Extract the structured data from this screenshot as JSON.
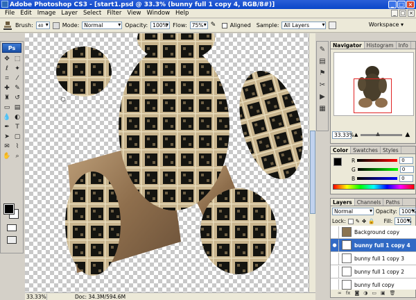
{
  "app": {
    "title": "Adobe Photoshop CS3 - [start1.psd @ 33.3% (bunny full 1 copy 4, RGB/8#)]",
    "win_min": "_",
    "win_max": "□",
    "win_close": "×"
  },
  "menu": [
    "File",
    "Edit",
    "Image",
    "Layer",
    "Select",
    "Filter",
    "View",
    "Window",
    "Help"
  ],
  "doc_controls": [
    "_",
    "□",
    "×"
  ],
  "options": {
    "brush_label": "Brush:",
    "brush_size": "40",
    "mode_label": "Mode:",
    "mode_value": "Normal",
    "opacity_label": "Opacity:",
    "opacity_value": "100%",
    "flow_label": "Flow:",
    "flow_value": "75%",
    "aligned_label": "Aligned",
    "sample_label": "Sample:",
    "sample_value": "All Layers",
    "workspace_label": "Workspace"
  },
  "toolbox": {
    "logo": "Ps"
  },
  "status": {
    "zoom": "33.33%",
    "doc": "Doc: 34.3M/594.6M"
  },
  "navigator": {
    "tabs": [
      "Navigator",
      "Histogram",
      "Info"
    ],
    "zoom": "33.33%"
  },
  "color": {
    "tabs": [
      "Color",
      "Swatches",
      "Styles"
    ],
    "channels": [
      {
        "label": "R",
        "value": "0"
      },
      {
        "label": "G",
        "value": "0"
      },
      {
        "label": "B",
        "value": "0"
      }
    ]
  },
  "layers": {
    "tabs": [
      "Layers",
      "Channels",
      "Paths"
    ],
    "blend_mode": "Normal",
    "opacity_label": "Opacity:",
    "opacity_value": "100%",
    "lock_label": "Lock:",
    "fill_label": "Fill:",
    "fill_value": "100%",
    "items": [
      {
        "name": "Background copy",
        "selected": false
      },
      {
        "name": "bunny full 1 copy 4",
        "selected": true
      },
      {
        "name": "bunny full 1 copy 3",
        "selected": false
      },
      {
        "name": "bunny full 1 copy 2",
        "selected": false
      },
      {
        "name": "bunny full copy",
        "selected": false
      }
    ]
  },
  "colors": {
    "title_bar": "#0b46c8",
    "selection": "#316ac5",
    "panel_bg": "#ece9d8",
    "fur_light": "#c8b89a",
    "fur_dark": "#1a1a14",
    "wood": "#9a7a58"
  }
}
